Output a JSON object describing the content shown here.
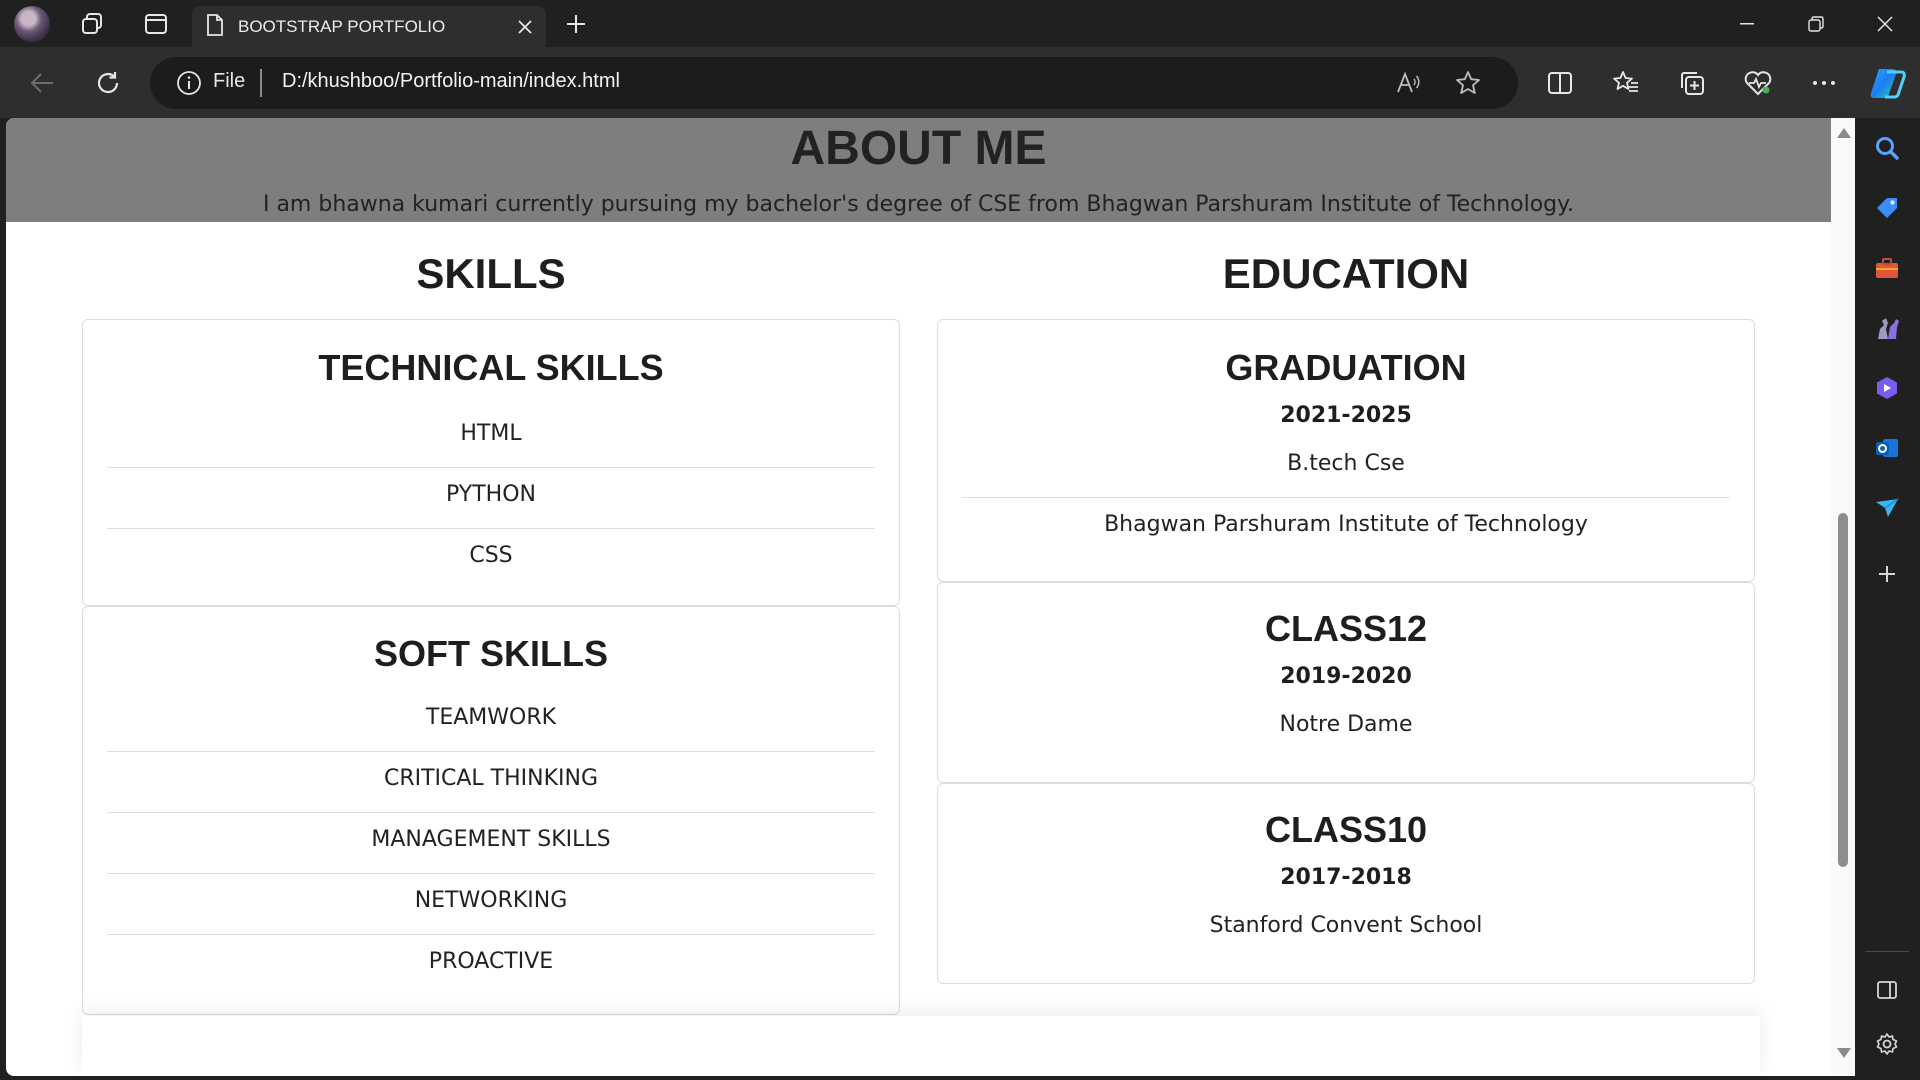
{
  "browser": {
    "tab_title": "BOOTSTRAP PORTFOLIO",
    "address_scheme": "File",
    "address_url": "D:/khushboo/Portfolio-main/index.html"
  },
  "page": {
    "about": {
      "title": "ABOUT ME",
      "text": "I am bhawna kumari currently pursuing my bachelor's degree of CSE from Bhagwan Parshuram Institute of Technology."
    },
    "skills": {
      "title": "SKILLS",
      "technical": {
        "title": "TECHNICAL SKILLS",
        "items": [
          "HTML",
          "PYTHON",
          "CSS"
        ]
      },
      "soft": {
        "title": "SOFT SKILLS",
        "items": [
          "TEAMWORK",
          "CRITICAL THINKING",
          "MANAGEMENT SKILLS",
          "NETWORKING",
          "PROACTIVE"
        ]
      }
    },
    "education": {
      "title": "EDUCATION",
      "graduation": {
        "title": "GRADUATION",
        "years": "2021-2025",
        "degree": "B.tech Cse",
        "institute": "Bhagwan Parshuram Institute of Technology"
      },
      "class12": {
        "title": "CLASS12",
        "years": "2019-2020",
        "school": "Notre Dame"
      },
      "class10": {
        "title": "CLASS10",
        "years": "2017-2018",
        "school": "Stanford Convent School"
      }
    }
  },
  "icons": {
    "sidebar": [
      "search-icon",
      "shopping-tag-icon",
      "toolbox-icon",
      "games-icon",
      "copilot-icon",
      "outlook-icon",
      "send-icon",
      "add-icon",
      "split-panel-icon",
      "settings-icon"
    ]
  }
}
